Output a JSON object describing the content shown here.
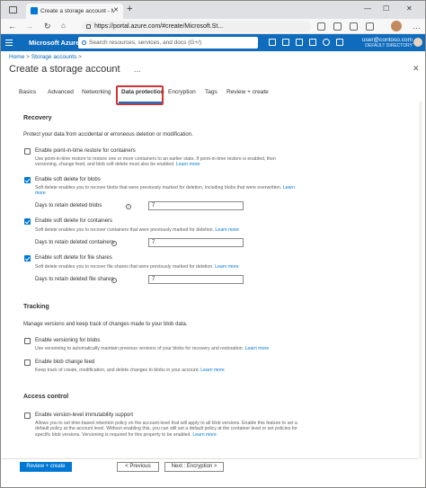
{
  "browser": {
    "tab_title": "Create a storage account - Micro",
    "tab_close": "✕",
    "new_tab": "+",
    "url": "https://portal.azure.com/#create/Microsoft.St...",
    "back": "←",
    "reload": "↻",
    "minimize": "—",
    "maximize": "☐",
    "close": "✕"
  },
  "azure": {
    "brand": "Microsoft Azure",
    "search_placeholder": "Search resources, services, and docs (G+/)",
    "user_email": "user@contoso.com",
    "user_directory": "DEFAULT DIRECTORY"
  },
  "breadcrumb": {
    "home": "Home",
    "sep": ">",
    "current": "Storage accounts",
    "sep2": ">"
  },
  "page": {
    "title": "Create a storage account",
    "ellipsis": "...",
    "close": "✕"
  },
  "tabs": [
    {
      "label": "Basics"
    },
    {
      "label": "Advanced"
    },
    {
      "label": "Networking"
    },
    {
      "label": "Data protection"
    },
    {
      "label": "Encryption"
    },
    {
      "label": "Tags"
    },
    {
      "label": "Review + create"
    }
  ],
  "recovery": {
    "heading": "Recovery",
    "intro": "Protect your data from accidental or erroneous deletion or modification.",
    "pitr": {
      "label": "Enable point-in-time restore for containers",
      "checked": false,
      "help": "Use point-in-time restore to restore one or more containers to an earlier state. If point-in-time restore is enabled, then versioning, change feed, and blob soft delete must also be enabled.",
      "link": "Learn more"
    },
    "blob_soft_delete": {
      "label": "Enable soft delete for blobs",
      "checked": true,
      "help": "Soft delete enables you to recover blobs that were previously marked for deletion, including blobs that were overwritten.",
      "link": "Learn more",
      "field_label": "Days to retain deleted blobs",
      "value": "7"
    },
    "container_soft_delete": {
      "label": "Enable soft delete for containers",
      "checked": true,
      "help": "Soft delete enables you to recover containers that were previously marked for deletion.",
      "link": "Learn more",
      "field_label": "Days to retain deleted containers",
      "value": "7"
    },
    "share_soft_delete": {
      "label": "Enable soft delete for file shares",
      "checked": true,
      "help": "Soft delete enables you to recover file shares that were previously marked for deletion.",
      "link": "Learn more",
      "field_label": "Days to retain deleted file shares",
      "value": "7"
    }
  },
  "tracking": {
    "heading": "Tracking",
    "intro": "Manage versions and keep track of changes made to your blob data.",
    "versioning": {
      "label": "Enable versioning for blobs",
      "checked": false,
      "help": "Use versioning to automatically maintain previous versions of your blobs for recovery and restoration.",
      "link": "Learn more"
    },
    "change_feed": {
      "label": "Enable blob change feed",
      "checked": false,
      "help": "Keep track of create, modification, and delete changes to blobs in your account.",
      "link": "Learn more"
    }
  },
  "access": {
    "heading": "Access control",
    "immutability": {
      "label": "Enable version-level immutability support",
      "checked": false,
      "help": "Allows you to set time-based retention policy on the account-level that will apply to all blob versions. Enable this feature to set a default policy at the account level. Without enabling this, you can still set a default policy at the container level or set policies for specific blob versions. Versioning is required for this property to be enabled.",
      "link": "Learn more"
    }
  },
  "footer": {
    "review": "Review + create",
    "previous": "< Previous",
    "next": "Next : Encryption >"
  },
  "icons": {
    "info": "i",
    "info_icon_name": "info-icon",
    "accent": "#0078d4",
    "header_bg": "#0f6cbd",
    "highlight": "#d13438"
  }
}
